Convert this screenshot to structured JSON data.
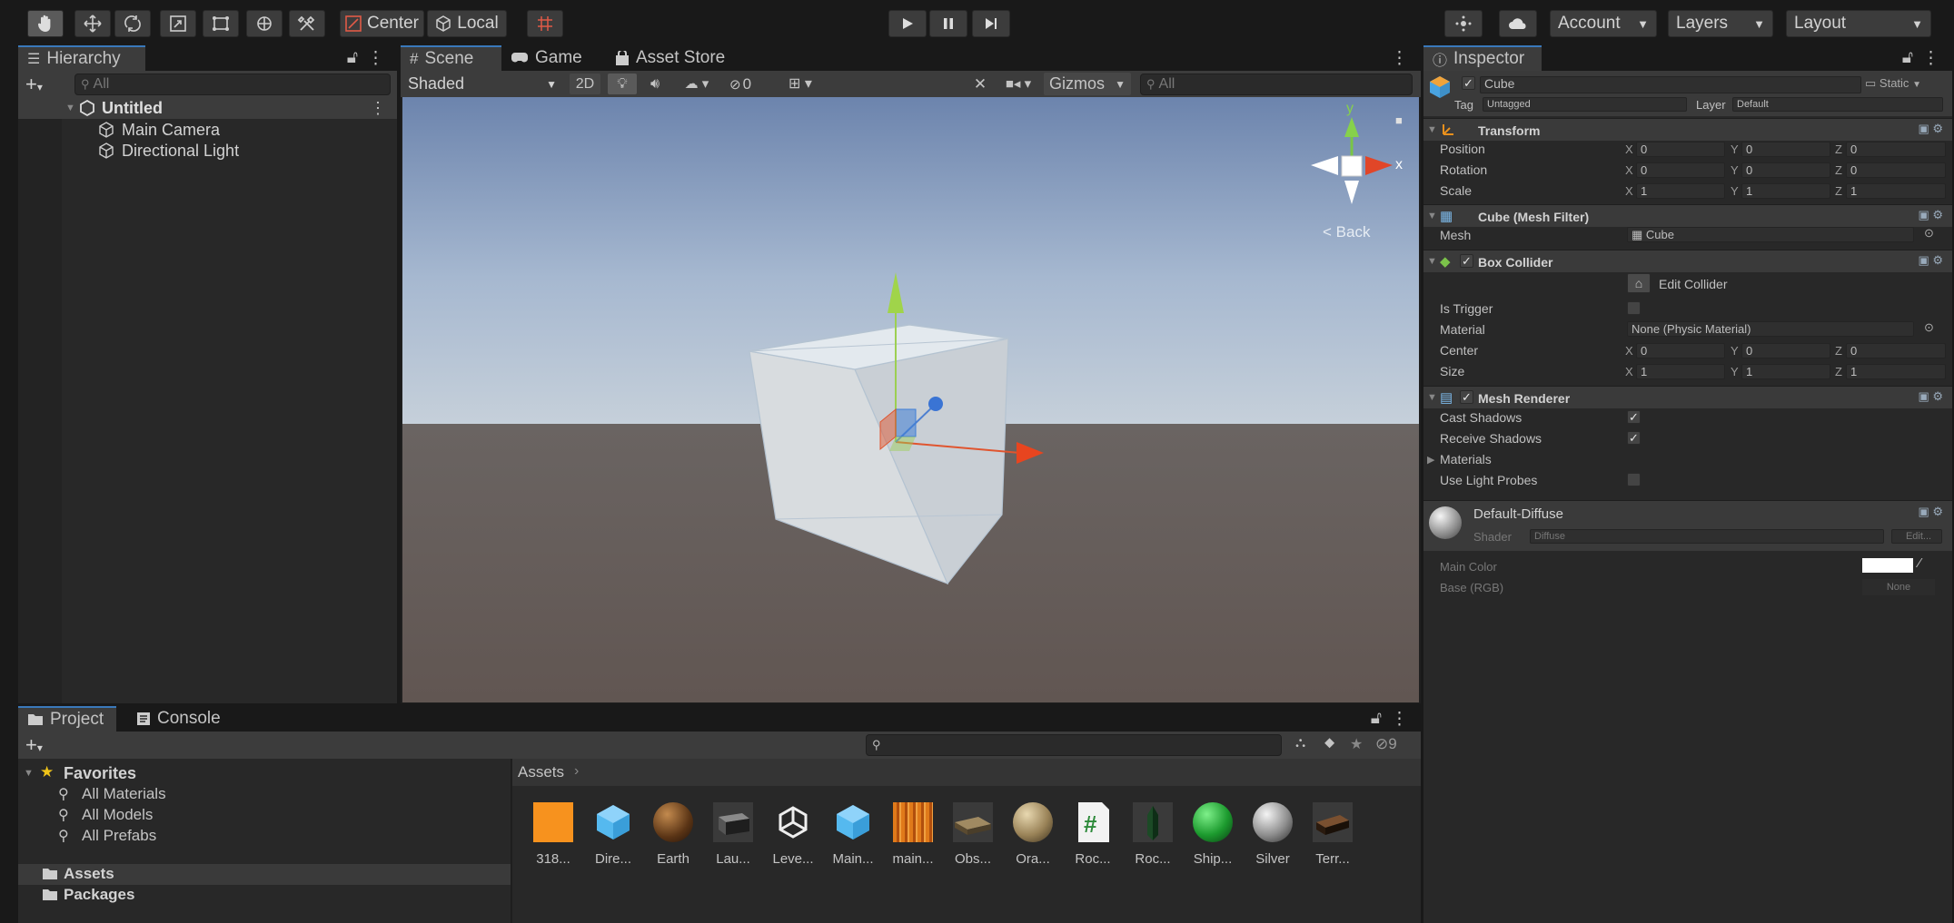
{
  "toolbar": {
    "pivot_label": "Center",
    "space_label": "Local",
    "account_label": "Account",
    "layers_label": "Layers",
    "layout_label": "Layout"
  },
  "hierarchy": {
    "tab": "Hierarchy",
    "search_placeholder": "All",
    "scene_name": "Untitled",
    "items": [
      {
        "label": "Main Camera"
      },
      {
        "label": "Directional Light"
      }
    ]
  },
  "scene": {
    "tabs": [
      {
        "label": "Scene"
      },
      {
        "label": "Game"
      },
      {
        "label": "Asset Store"
      }
    ],
    "shading": "Shaded",
    "mode_2d": "2D",
    "hidden_count": "0",
    "gizmos_label": "Gizmos",
    "search_placeholder": "All",
    "back_label": "< Back",
    "axis_y": "y",
    "axis_x": "x"
  },
  "inspector": {
    "tab": "Inspector",
    "object_name": "Cube",
    "static_label": "Static",
    "tag_label": "Tag",
    "tag_value": "Untagged",
    "layer_label": "Layer",
    "layer_value": "Default",
    "transform": {
      "title": "Transform",
      "rows": [
        {
          "label": "Position",
          "x": "0",
          "y": "0",
          "z": "0"
        },
        {
          "label": "Rotation",
          "x": "0",
          "y": "0",
          "z": "0"
        },
        {
          "label": "Scale",
          "x": "1",
          "y": "1",
          "z": "1"
        }
      ]
    },
    "mesh_filter": {
      "title": "Cube (Mesh Filter)",
      "mesh_label": "Mesh",
      "mesh_value": "Cube"
    },
    "box_collider": {
      "title": "Box Collider",
      "edit_label": "Edit Collider",
      "is_trigger_label": "Is Trigger",
      "material_label": "Material",
      "material_value": "None (Physic Material)",
      "center_label": "Center",
      "center": {
        "x": "0",
        "y": "0",
        "z": "0"
      },
      "size_label": "Size",
      "size": {
        "x": "1",
        "y": "1",
        "z": "1"
      }
    },
    "mesh_renderer": {
      "title": "Mesh Renderer",
      "cast_shadows": "Cast Shadows",
      "receive_shadows": "Receive Shadows",
      "materials": "Materials",
      "use_light_probes": "Use Light Probes"
    },
    "material": {
      "name": "Default-Diffuse",
      "shader_label": "Shader",
      "shader_value": "Diffuse",
      "edit_label": "Edit...",
      "main_color_label": "Main Color",
      "base_label": "Base (RGB)",
      "texture_value": "None"
    }
  },
  "project": {
    "tabs": [
      {
        "label": "Project"
      },
      {
        "label": "Console"
      }
    ],
    "hidden_count": "9",
    "favorites_label": "Favorites",
    "favorites": [
      {
        "label": "All Materials"
      },
      {
        "label": "All Models"
      },
      {
        "label": "All Prefabs"
      }
    ],
    "folders": [
      {
        "label": "Assets"
      },
      {
        "label": "Packages"
      }
    ],
    "breadcrumb": "Assets",
    "assets": [
      {
        "label": "318...",
        "icon": "orange-texture"
      },
      {
        "label": "Dire...",
        "icon": "prefab-cube"
      },
      {
        "label": "Earth",
        "icon": "sphere-brown"
      },
      {
        "label": "Lau...",
        "icon": "model-dark"
      },
      {
        "label": "Leve...",
        "icon": "unity-scene"
      },
      {
        "label": "Main...",
        "icon": "prefab-cube"
      },
      {
        "label": "main...",
        "icon": "flame-texture"
      },
      {
        "label": "Obs...",
        "icon": "model-slab"
      },
      {
        "label": "Ora...",
        "icon": "sphere-tan"
      },
      {
        "label": "Roc...",
        "icon": "csharp-script"
      },
      {
        "label": "Roc...",
        "icon": "model-rocket"
      },
      {
        "label": "Ship...",
        "icon": "sphere-green"
      },
      {
        "label": "Silver",
        "icon": "sphere-silver"
      },
      {
        "label": "Terr...",
        "icon": "model-terrain"
      }
    ]
  }
}
